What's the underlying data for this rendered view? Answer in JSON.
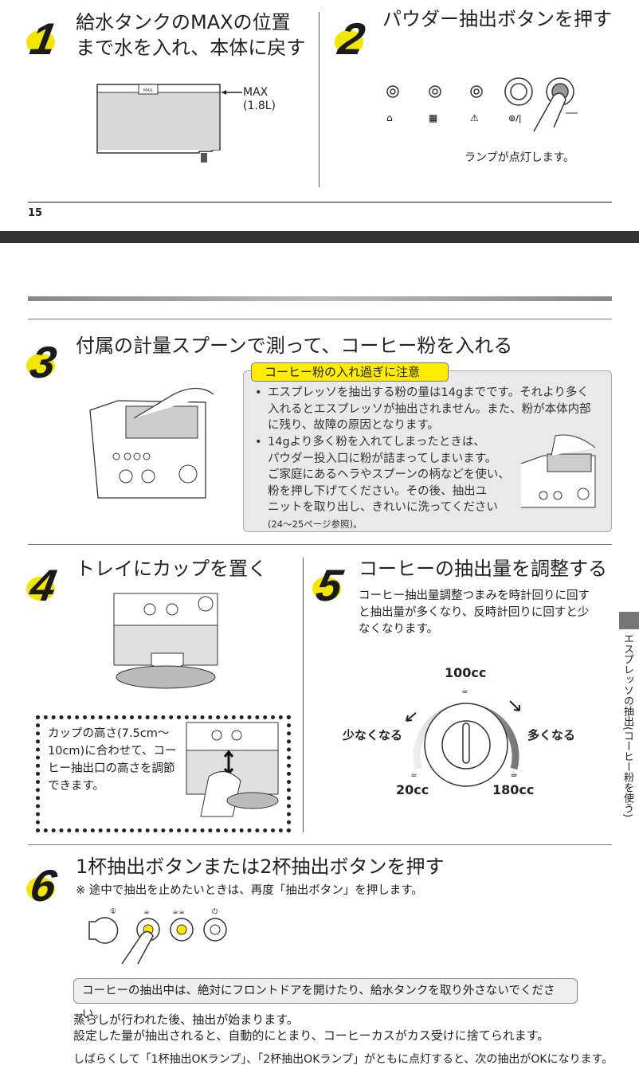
{
  "page_number": "15",
  "steps": [
    {
      "num": "1",
      "title_l1": "給水タンクのMAXの位置",
      "title_l2": "まで水を入れ、本体に戻す",
      "max_label": "MAX",
      "max_volume": "(1.8L)",
      "tank_mark": "MAX"
    },
    {
      "num": "2",
      "title": "パウダー抽出ボタンを押す",
      "caption": "ランプが点灯します。"
    },
    {
      "num": "3",
      "title": "付属の計量スプーンで測って、コーヒー粉を入れる",
      "warning_title": "コーヒー粉の入れ過ぎに注意",
      "bullet1": [
        "エスプレッソを抽出する粉の量は14gまでです。それより多く",
        "入れるとエスプレッソが抽出されません。また、粉が本体内部",
        "に残り、故障の原因となります。"
      ],
      "bullet2": [
        "14gより多く粉を入れてしまったときは、",
        "パウダー投入口に粉が詰まってしまいます。",
        "ご家庭にあるヘラやスプーンの柄などを使い、",
        "粉を押し下げてください。その後、抽出ユ",
        "ニットを取り出し、きれいに洗ってください"
      ],
      "bullet2_ref": "(24〜25ページ参照)。"
    },
    {
      "num": "4",
      "title": "トレイにカップを置く",
      "note": [
        "カップの高さ(7.5cm〜",
        "10cm)に合わせて、コー",
        "ヒー抽出口の高さを調節",
        "できます。"
      ]
    },
    {
      "num": "5",
      "title": "コーヒーの抽出量を調整する",
      "desc": [
        "コーヒー抽出量調整つまみを時計回りに回す",
        "と抽出量が多くなり、反時計回りに回すと少",
        "なくなります。"
      ],
      "dial": {
        "top": "100cc",
        "left": "少なくなる",
        "right": "多くなる",
        "min": "20cc",
        "max": "180cc"
      }
    },
    {
      "num": "6",
      "title": "1杯抽出ボタンまたは2杯抽出ボタンを押す",
      "note": "※ 途中で抽出を止めたいときは、再度「抽出ボタン」を押します。"
    }
  ],
  "notice": "コーヒーの抽出中は、絶対にフロントドアを開けたり、給水タンクを取り外さないでください。",
  "footer_lines": [
    "蒸らしが行われた後、抽出が始まります。",
    "設定した量が抽出されると、自動的にとまり、コーヒーカスがカス受けに捨てられます。",
    "しばらくして「1杯抽出OKランプ」、「2杯抽出OKランプ」がともに点灯すると、次の抽出がOKになります。"
  ],
  "side_tab": "エスプレッソの抽出(コーヒー粉を使う)",
  "colors": {
    "accent_yellow": "#f3e600",
    "warning_label": "#ffec00",
    "dark_bar": "#333333"
  }
}
